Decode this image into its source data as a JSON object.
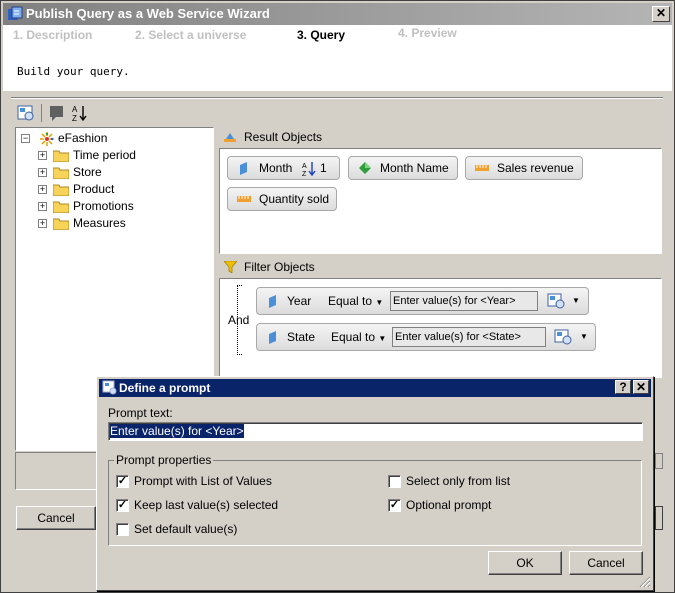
{
  "wizard": {
    "title": "Publish Query as a Web Service Wizard",
    "close_glyph": "✕",
    "steps": [
      "1. Description",
      "2. Select a universe",
      "3. Query",
      "4. Preview"
    ],
    "instruction": "Build your query.",
    "cancel_label": "Cancel"
  },
  "tree": {
    "root": "eFashion",
    "items": [
      "Time period",
      "Store",
      "Product",
      "Promotions",
      "Measures"
    ]
  },
  "result_objects": {
    "header": "Result Objects",
    "items": [
      {
        "label": "Month",
        "sort_glyph": "A↓Z",
        "sort_order": "1",
        "kind": "dimension"
      },
      {
        "label": "Month Name",
        "kind": "detail"
      },
      {
        "label": "Sales revenue",
        "kind": "measure"
      },
      {
        "label": "Quantity sold",
        "kind": "measure"
      }
    ]
  },
  "filter_objects": {
    "header": "Filter Objects",
    "operator": "And",
    "filters": [
      {
        "object": "Year",
        "condition": "Equal to",
        "value": "Enter value(s) for <Year>"
      },
      {
        "object": "State",
        "condition": "Equal to",
        "value": "Enter value(s) for <State>"
      }
    ]
  },
  "prompt_dialog": {
    "title": "Define a prompt",
    "help_glyph": "?",
    "close_glyph": "✕",
    "prompt_text_label": "Prompt text:",
    "prompt_text_value": "Enter value(s) for <Year>",
    "group_label": "Prompt properties",
    "options": [
      {
        "label": "Prompt with List of Values",
        "checked": true
      },
      {
        "label": "Keep last value(s) selected",
        "checked": true
      },
      {
        "label": "Set default value(s)",
        "checked": false
      },
      {
        "label": "Select only from list",
        "checked": false
      },
      {
        "label": "Optional prompt",
        "checked": true
      }
    ],
    "ok_label": "OK",
    "cancel_label": "Cancel"
  },
  "colors": {
    "active_title": "#0a246a",
    "inactive_title": "#808080",
    "measure_orange": "#f0a030",
    "dimension_blue": "#4a90d9",
    "detail_green": "#2e9e3a",
    "filter_yellow": "#f0c000"
  }
}
